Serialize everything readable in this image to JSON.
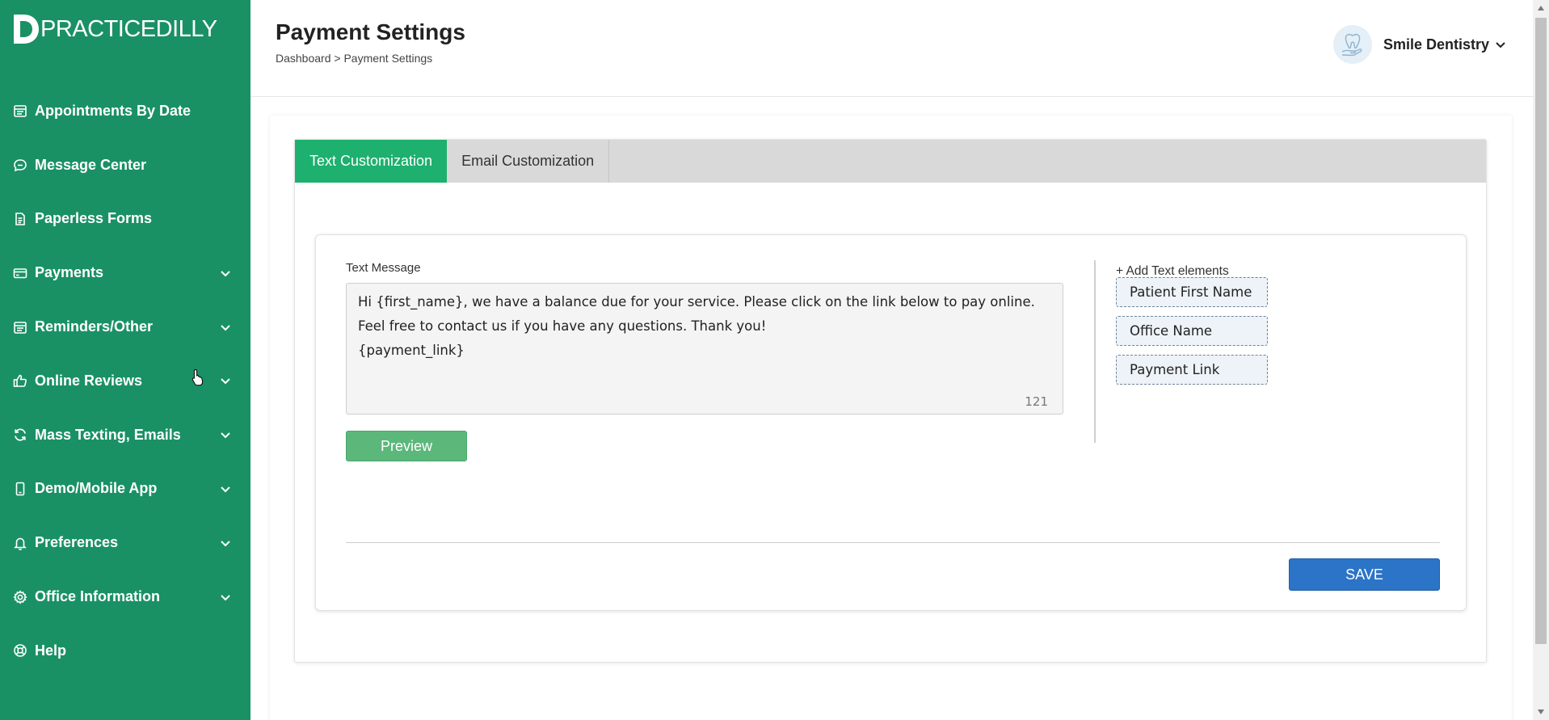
{
  "brand": {
    "name": "PRACTICEDILLY",
    "color": "#1a9165"
  },
  "sidebar": {
    "items": [
      {
        "label": "Appointments By Date",
        "icon": "calendar-icon",
        "expandable": false
      },
      {
        "label": "Message Center",
        "icon": "chat-icon",
        "expandable": false
      },
      {
        "label": "Paperless Forms",
        "icon": "document-icon",
        "expandable": false
      },
      {
        "label": "Payments",
        "icon": "credit-card-icon",
        "expandable": true
      },
      {
        "label": "Reminders/Other",
        "icon": "calendar-icon",
        "expandable": true
      },
      {
        "label": "Online Reviews",
        "icon": "thumbs-up-icon",
        "expandable": true
      },
      {
        "label": "Mass Texting, Emails",
        "icon": "refresh-icon",
        "expandable": true
      },
      {
        "label": "Demo/Mobile App",
        "icon": "mobile-icon",
        "expandable": true
      },
      {
        "label": "Preferences",
        "icon": "bell-icon",
        "expandable": true
      },
      {
        "label": "Office Information",
        "icon": "gear-icon",
        "expandable": true
      },
      {
        "label": "Help",
        "icon": "lifebuoy-icon",
        "expandable": false
      }
    ]
  },
  "header": {
    "title": "Payment Settings",
    "breadcrumb": "Dashboard > Payment Settings",
    "profile_name": "Smile Dentistry",
    "avatar_icon": "tooth-icon"
  },
  "tabs": [
    {
      "label": "Text Customization",
      "active": true
    },
    {
      "label": "Email Customization",
      "active": false
    }
  ],
  "text_message": {
    "label": "Text Message",
    "value": "Hi {first_name}, we have a balance due for your service. Please click on the link below to pay online. Feel free to contact us if you have any questions. Thank you!\n{payment_link}",
    "char_count": "121"
  },
  "buttons": {
    "preview": "Preview",
    "save": "SAVE"
  },
  "text_elements": {
    "title": "+ Add Text elements",
    "chips": [
      "Patient First Name",
      "Office Name",
      "Payment Link"
    ]
  },
  "colors": {
    "tab_active": "#1db06e",
    "save": "#2b74c7",
    "preview": "#5cb87a"
  }
}
